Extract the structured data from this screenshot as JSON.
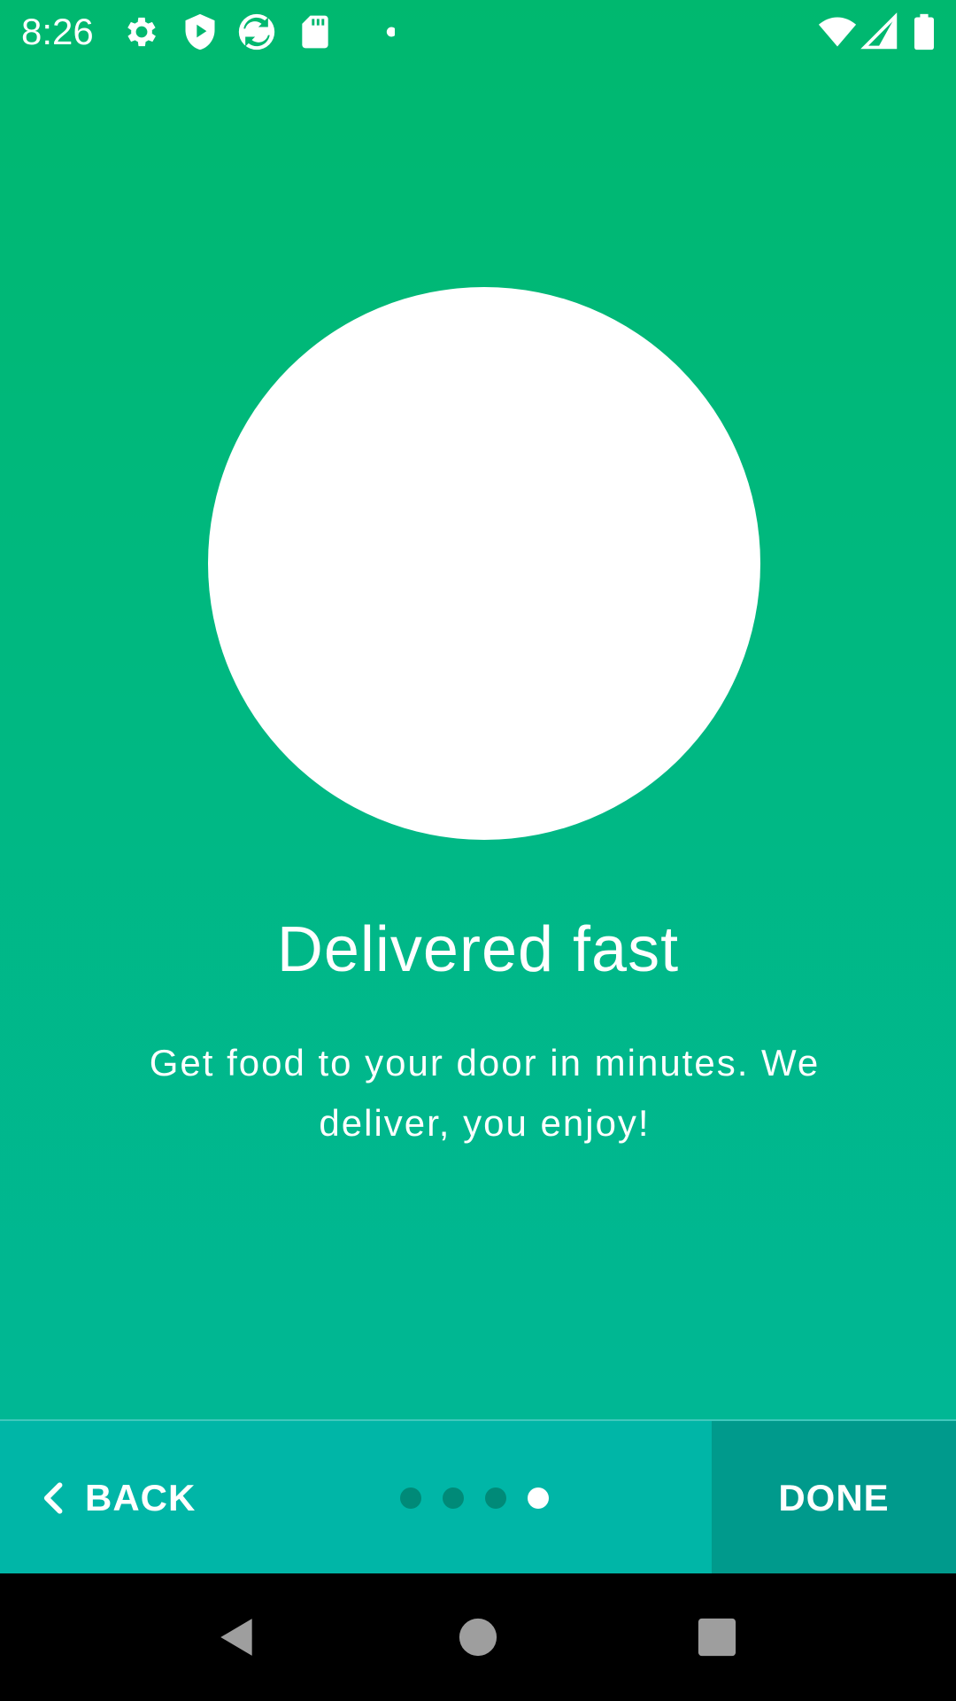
{
  "status_bar": {
    "time": "8:26",
    "left_icons": [
      "gear-icon",
      "shield-play-icon",
      "sync-app-icon",
      "sd-card-icon",
      "notification-dot-icon"
    ],
    "right_icons": [
      "wifi-icon",
      "cell-signal-icon",
      "battery-icon"
    ]
  },
  "onboarding": {
    "title": "Delivered fast",
    "description": "Get food to your door in minutes. We deliver, you enjoy!",
    "page_count": 4,
    "current_page": 4
  },
  "bottom_bar": {
    "back_label": "BACK",
    "done_label": "DONE"
  },
  "system_nav": {
    "buttons": [
      "back-triangle-icon",
      "home-circle-icon",
      "recents-square-icon"
    ]
  },
  "colors": {
    "gradient_top": "#00b86f",
    "gradient_bottom": "#00b79c",
    "bottom_bar": "#00b6a7",
    "done_bg": "#009a8c",
    "inactive_dot": "#008a78",
    "active_dot": "#ffffff"
  }
}
